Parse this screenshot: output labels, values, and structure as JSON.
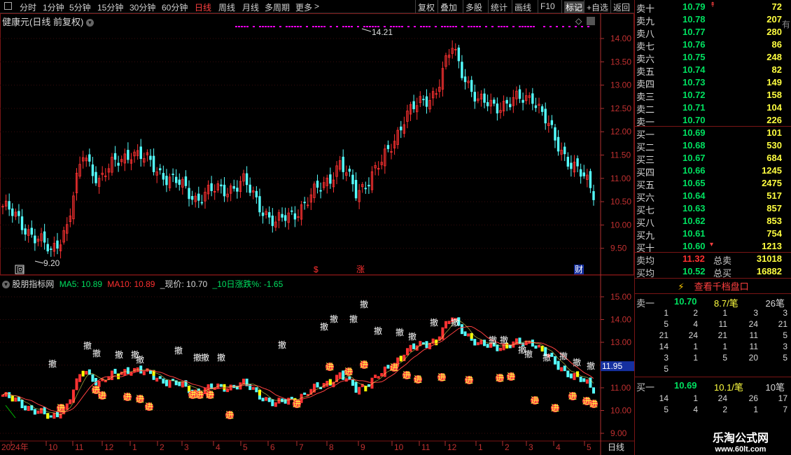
{
  "toolbar": {
    "periods": [
      "分时",
      "1分钟",
      "5分钟",
      "15分钟",
      "30分钟",
      "60分钟",
      "日线",
      "周线",
      "月线",
      "多周期",
      "更多"
    ],
    "active_period": "日线",
    "more_arrow": ">",
    "actions": [
      "复权",
      "叠加",
      "多股",
      "统计",
      "画线",
      "F10",
      "标记",
      "+自选",
      "返回"
    ],
    "active_action": "标记"
  },
  "main_chart": {
    "title": "健康元(日线 前复权)",
    "price_axis": [
      "14.00",
      "13.50",
      "13.00",
      "12.50",
      "12.00",
      "11.50",
      "11.00",
      "10.50",
      "10.00",
      "9.50"
    ],
    "high_label": "14.21",
    "low_label": "9.20",
    "markers": [
      "$",
      "涨",
      "财"
    ],
    "box_marker": "回",
    "diamond": "◇"
  },
  "indicator": {
    "name": "股朋指标网",
    "ma5_label": "MA5: 10.89",
    "ma10_label": "MA10: 10.89",
    "current_label": "_现价: 10.70",
    "change_label": "_10日涨跌%: -1.65",
    "price_axis": [
      "15.00",
      "14.00",
      "13.00",
      "12.00",
      "11.00",
      "10.00",
      "9.00"
    ],
    "current_tag": "11.95",
    "buy_mark": "进",
    "sell_mark": "撤"
  },
  "date_axis": {
    "labels": [
      "2024年",
      "10",
      "11",
      "12",
      "1",
      "2",
      "3",
      "4",
      "5",
      "6",
      "7",
      "8",
      "9",
      "10",
      "11",
      "12",
      "1",
      "2",
      "3",
      "4",
      "5"
    ],
    "period_label": "日线"
  },
  "colors": {
    "up": "#ff3232",
    "down": "#54ffff",
    "grid": "#7a1515",
    "axis": "#b03030",
    "ma5": "#ffffff",
    "ma10": "#ffff00",
    "green_text": "#00e060",
    "red_text": "#ff3030",
    "magenta": "#ff00ff"
  },
  "orderbook": {
    "sell": [
      {
        "label": "卖十",
        "price": "10.79",
        "vol": "72",
        "flag": "↟"
      },
      {
        "label": "卖九",
        "price": "10.78",
        "vol": "207",
        "flag": ""
      },
      {
        "label": "卖八",
        "price": "10.77",
        "vol": "280",
        "flag": ""
      },
      {
        "label": "卖七",
        "price": "10.76",
        "vol": "86",
        "flag": ""
      },
      {
        "label": "卖六",
        "price": "10.75",
        "vol": "248",
        "flag": ""
      },
      {
        "label": "卖五",
        "price": "10.74",
        "vol": "82",
        "flag": ""
      },
      {
        "label": "卖四",
        "price": "10.73",
        "vol": "149",
        "flag": ""
      },
      {
        "label": "卖三",
        "price": "10.72",
        "vol": "158",
        "flag": ""
      },
      {
        "label": "卖二",
        "price": "10.71",
        "vol": "104",
        "flag": ""
      },
      {
        "label": "卖一",
        "price": "10.70",
        "vol": "226",
        "flag": ""
      }
    ],
    "buy": [
      {
        "label": "买一",
        "price": "10.69",
        "vol": "101",
        "flag": ""
      },
      {
        "label": "买二",
        "price": "10.68",
        "vol": "530",
        "flag": ""
      },
      {
        "label": "买三",
        "price": "10.67",
        "vol": "684",
        "flag": ""
      },
      {
        "label": "买四",
        "price": "10.66",
        "vol": "1245",
        "flag": ""
      },
      {
        "label": "买五",
        "price": "10.65",
        "vol": "2475",
        "flag": ""
      },
      {
        "label": "买六",
        "price": "10.64",
        "vol": "517",
        "flag": ""
      },
      {
        "label": "买七",
        "price": "10.63",
        "vol": "857",
        "flag": ""
      },
      {
        "label": "买八",
        "price": "10.62",
        "vol": "853",
        "flag": ""
      },
      {
        "label": "买九",
        "price": "10.61",
        "vol": "754",
        "flag": ""
      },
      {
        "label": "买十",
        "price": "10.60",
        "vol": "1213",
        "flag": "▾"
      }
    ],
    "avg_sell": {
      "label": "卖均",
      "price": "11.32",
      "total_label": "总卖",
      "total": "31018"
    },
    "avg_buy": {
      "label": "买均",
      "price": "10.52",
      "total_label": "总买",
      "total": "16882"
    },
    "depth_button": "查看千档盘口",
    "sell1_detail": {
      "label": "卖一",
      "price": "10.70",
      "per": "8.7/笔",
      "count": "26笔"
    },
    "sell1_grid": [
      [
        "1",
        "2",
        "1",
        "3",
        "3"
      ],
      [
        "5",
        "4",
        "11",
        "24",
        "21"
      ],
      [
        "21",
        "24",
        "21",
        "11",
        "5"
      ],
      [
        "14",
        "1",
        "1",
        "11",
        "3"
      ],
      [
        "3",
        "1",
        "5",
        "20",
        "5"
      ],
      [
        "5",
        "",
        "",
        "",
        ""
      ]
    ],
    "buy1_detail": {
      "label": "买一",
      "price": "10.69",
      "per": "10.1/笔",
      "count": "10笔"
    },
    "buy1_grid": [
      [
        "14",
        "1",
        "24",
        "26",
        "17"
      ],
      [
        "5",
        "4",
        "2",
        "1",
        "7"
      ]
    ],
    "right_edge_text": "有"
  },
  "watermark": {
    "title": "乐淘公式网",
    "url": "www.60lt.com"
  }
}
